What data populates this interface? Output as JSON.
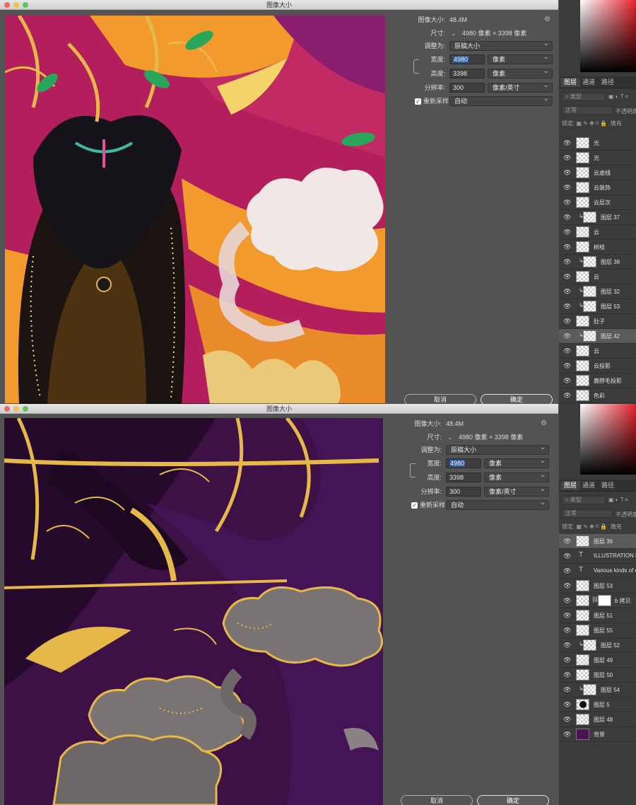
{
  "screens": [
    {
      "window_title": "图像大小",
      "image_size_label": "图像大小:",
      "image_size_value": "48.4M",
      "dimensions_label": "尺寸:",
      "dimensions_value": "4980 像素 × 3398 像素",
      "fit_to_label": "调整为:",
      "fit_to_value": "原稿大小",
      "width_label": "宽度:",
      "width_value": "4980",
      "width_unit": "像素",
      "height_label": "高度:",
      "height_value": "3398",
      "height_unit": "像素",
      "resolution_label": "分辨率:",
      "resolution_value": "300",
      "resolution_unit": "像素/英寸",
      "resample_label": "重新采样:",
      "resample_value": "自动",
      "cancel_label": "取消",
      "ok_label": "确定",
      "panel_tabs": [
        "图层",
        "通道",
        "路径"
      ],
      "filter_placeholder": "类型",
      "blend_mode": "正常",
      "opacity_label": "不透明度",
      "lock_label": "锁定:",
      "fill_label": "填充",
      "layers": [
        {
          "name": "光",
          "kind": "pixel"
        },
        {
          "name": "光",
          "kind": "pixel"
        },
        {
          "name": "云虚线",
          "kind": "pixel"
        },
        {
          "name": "云装饰",
          "kind": "pixel"
        },
        {
          "name": "云层次",
          "kind": "pixel"
        },
        {
          "name": "图层 37",
          "kind": "clip"
        },
        {
          "name": "云",
          "kind": "pixel"
        },
        {
          "name": "树枝",
          "kind": "pixel"
        },
        {
          "name": "图层 38",
          "kind": "clip"
        },
        {
          "name": "云",
          "kind": "pixel"
        },
        {
          "name": "图层 32",
          "kind": "clip"
        },
        {
          "name": "图层 53",
          "kind": "clip"
        },
        {
          "name": "肚子",
          "kind": "pixel"
        },
        {
          "name": "图层 42",
          "kind": "clip",
          "selected": true
        },
        {
          "name": "云",
          "kind": "pixel"
        },
        {
          "name": "云投影",
          "kind": "pixel"
        },
        {
          "name": "鹿脖毛投影",
          "kind": "pixel"
        },
        {
          "name": "色彩",
          "kind": "pixel"
        }
      ]
    },
    {
      "window_title": "图像大小",
      "image_size_label": "图像大小:",
      "image_size_value": "48.4M",
      "dimensions_label": "尺寸:",
      "dimensions_value": "4980 像素 × 3398 像素",
      "fit_to_label": "调整为:",
      "fit_to_value": "原稿大小",
      "width_label": "宽度:",
      "width_value": "4980",
      "width_unit": "像素",
      "height_label": "高度:",
      "height_value": "3398",
      "height_unit": "像素",
      "resolution_label": "分辨率:",
      "resolution_value": "300",
      "resolution_unit": "像素/英寸",
      "resample_label": "重新采样:",
      "resample_value": "自动",
      "cancel_label": "取消",
      "ok_label": "确定",
      "panel_tabs": [
        "图层",
        "通道",
        "路径"
      ],
      "filter_placeholder": "类型",
      "blend_mode": "正常",
      "opacity_label": "不透明度",
      "lock_label": "锁定:",
      "fill_label": "填充",
      "layers": [
        {
          "name": "图层 36",
          "kind": "pixel",
          "selected": true
        },
        {
          "name": "ILLUSTRATION DE",
          "kind": "text"
        },
        {
          "name": "Various kinds of c",
          "kind": "text"
        },
        {
          "name": "图层 53",
          "kind": "pixel"
        },
        {
          "name": "b 拷贝",
          "kind": "masked"
        },
        {
          "name": "图层 51",
          "kind": "pixel"
        },
        {
          "name": "图层 55",
          "kind": "pixel"
        },
        {
          "name": "图层 52",
          "kind": "clip"
        },
        {
          "name": "图层 49",
          "kind": "pixel"
        },
        {
          "name": "图层 50",
          "kind": "pixel"
        },
        {
          "name": "图层 54",
          "kind": "clip"
        },
        {
          "name": "图层 5",
          "kind": "dot"
        },
        {
          "name": "图层 48",
          "kind": "pixel"
        },
        {
          "name": "背景",
          "kind": "solid"
        }
      ]
    }
  ],
  "icons": {
    "eye": "eye-icon",
    "gear": "gear-icon",
    "link": "link-icon",
    "clip": "clipping-arrow-icon",
    "text": "text-layer-icon"
  },
  "colors": {
    "selection": "#2d5b9c",
    "panel_bg": "#3b3b3b",
    "dialog_bg": "#535353",
    "art1_magenta": "#b21f5c",
    "art1_orange": "#f29a2e",
    "art2_purple": "#3d1146",
    "gold": "#e6b84a"
  }
}
